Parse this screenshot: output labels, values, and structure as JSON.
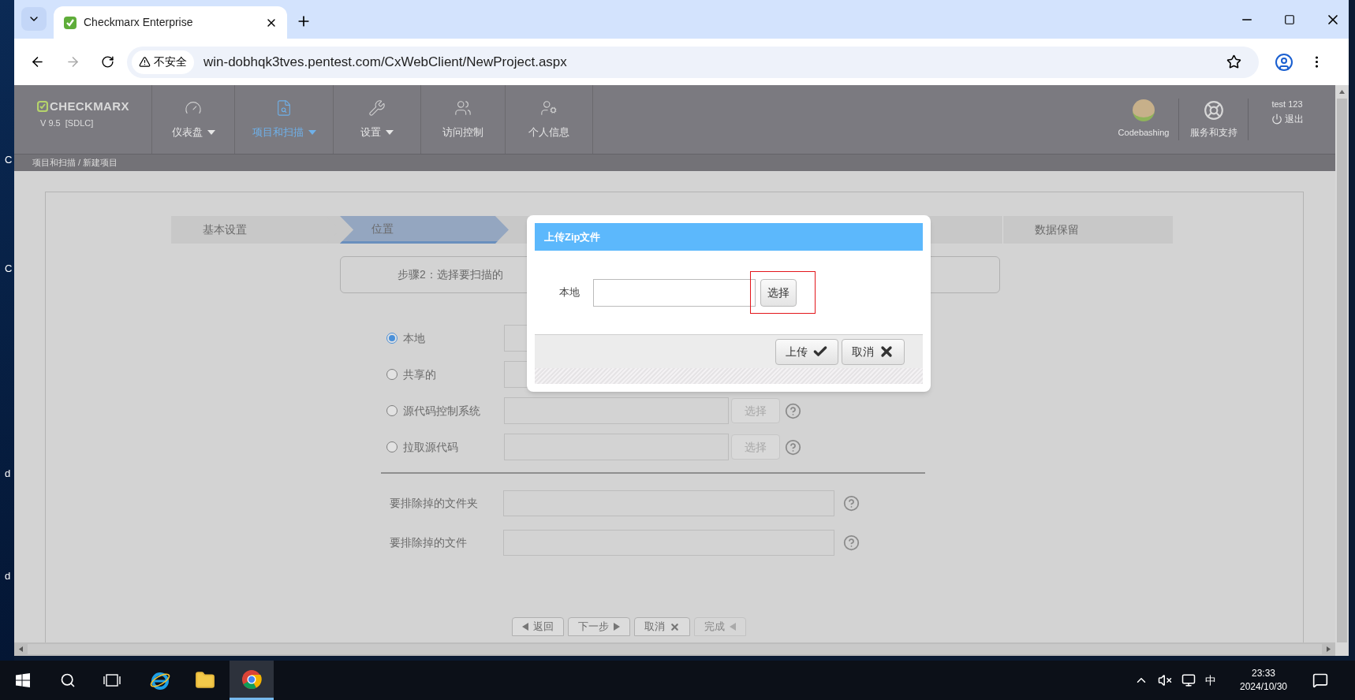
{
  "desktop": {
    "icon_labels": [
      "C",
      "C",
      "d",
      "d"
    ]
  },
  "browser": {
    "tab": {
      "title": "Checkmarx Enterprise"
    },
    "address_bar": {
      "security_label": "不安全",
      "url": "win-dobhqk3tves.pentest.com/CxWebClient/NewProject.aspx"
    }
  },
  "header": {
    "logo": "CHECKMARX",
    "version": "V 9.5  [SDLC]",
    "nav": [
      {
        "label": "仪表盘",
        "selected": false,
        "dropdown": true
      },
      {
        "label": "项目和扫描",
        "selected": true,
        "dropdown": true
      },
      {
        "label": "设置",
        "selected": false,
        "dropdown": true
      },
      {
        "label": "访问控制",
        "selected": false,
        "dropdown": false
      },
      {
        "label": "个人信息",
        "selected": false,
        "dropdown": false
      }
    ],
    "codebashing": "Codebashing",
    "support": "服务和支持",
    "user": "test 123",
    "logout": "退出"
  },
  "breadcrumb": "项目和扫描 / 新建项目",
  "wizard": {
    "steps": [
      {
        "label": "基本设置",
        "selected": false
      },
      {
        "label": "位置",
        "selected": true
      },
      {
        "label": "数据保留",
        "selected": false
      }
    ],
    "instruction": "步骤2：选择要扫描的"
  },
  "source_options": [
    {
      "label": "本地",
      "selected": true
    },
    {
      "label": "共享的",
      "selected": false
    },
    {
      "label": "源代码控制系统",
      "selected": false,
      "button": "选择"
    },
    {
      "label": "拉取源代码",
      "selected": false,
      "button": "选择"
    }
  ],
  "exclusions": [
    {
      "label": "要排除掉的文件夹"
    },
    {
      "label": "要排除掉的文件"
    }
  ],
  "nav_buttons": [
    {
      "label": "返回",
      "kind": "back",
      "disabled": false
    },
    {
      "label": "下一步",
      "kind": "next",
      "disabled": false
    },
    {
      "label": "取消",
      "kind": "cancel",
      "disabled": false
    },
    {
      "label": "完成",
      "kind": "finish",
      "disabled": true
    }
  ],
  "dialog": {
    "title": "上传Zip文件",
    "field_label": "本地",
    "browse_button": "选择",
    "buttons": [
      {
        "label": "上传",
        "kind": "confirm"
      },
      {
        "label": "取消",
        "kind": "cancel"
      }
    ]
  },
  "taskbar": {
    "input_method": "中",
    "time": "23:33",
    "date": "2024/10/30"
  }
}
